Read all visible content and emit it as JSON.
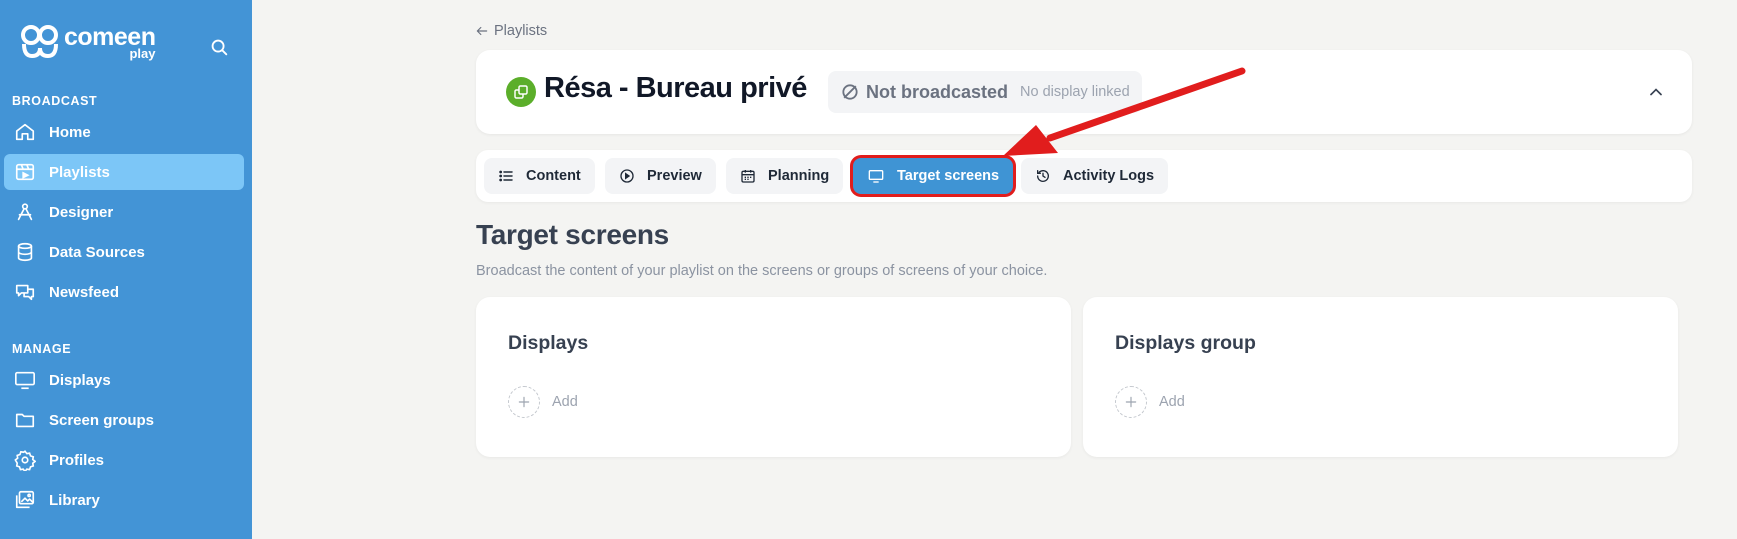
{
  "brand": {
    "name": "comeen",
    "sub": "play"
  },
  "sidebar": {
    "sections": [
      {
        "label": "BROADCAST",
        "items": [
          {
            "label": "Home",
            "icon": "home-icon"
          },
          {
            "label": "Playlists",
            "icon": "playlist-icon",
            "active": true
          },
          {
            "label": "Designer",
            "icon": "designer-icon"
          },
          {
            "label": "Data Sources",
            "icon": "database-icon"
          },
          {
            "label": "Newsfeed",
            "icon": "chat-icon"
          }
        ]
      },
      {
        "label": "MANAGE",
        "items": [
          {
            "label": "Displays",
            "icon": "monitor-icon"
          },
          {
            "label": "Screen groups",
            "icon": "folder-icon"
          },
          {
            "label": "Profiles",
            "icon": "gear-icon"
          },
          {
            "label": "Library",
            "icon": "images-icon"
          }
        ]
      }
    ]
  },
  "breadcrumb": {
    "back_label": "Playlists"
  },
  "playlist": {
    "title": "Résa - Bureau privé",
    "status": "Not broadcasted",
    "status_detail": "No display linked"
  },
  "tabs": [
    {
      "label": "Content",
      "icon": "list-icon"
    },
    {
      "label": "Preview",
      "icon": "play-icon"
    },
    {
      "label": "Planning",
      "icon": "calendar-icon"
    },
    {
      "label": "Target screens",
      "icon": "monitor-icon",
      "active": true
    },
    {
      "label": "Activity Logs",
      "icon": "history-icon"
    }
  ],
  "main": {
    "title": "Target screens",
    "description": "Broadcast the content of your playlist on the screens or groups of screens of your choice.",
    "panels": [
      {
        "title": "Displays",
        "add_label": "Add"
      },
      {
        "title": "Displays group",
        "add_label": "Add"
      }
    ]
  },
  "colors": {
    "sidebar": "#4394d6",
    "active_nav": "#7cc6f7",
    "active_tab": "#3f94d4",
    "annotation": "#e11d1d",
    "badge": "#5bae2a"
  }
}
